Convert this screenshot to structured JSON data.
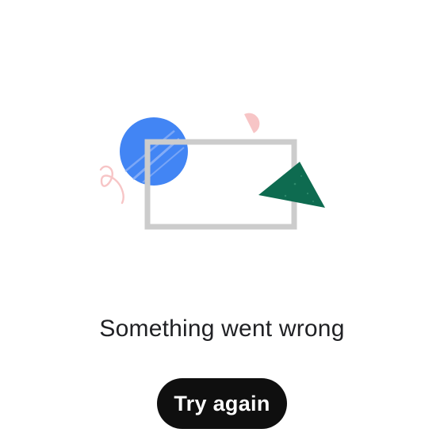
{
  "error": {
    "title": "Something went wrong",
    "retry_label": "Try again"
  },
  "illustration": {
    "circle_color": "#4285F4",
    "frame_color": "#CCCCCC",
    "triangle_color": "#0E6B50",
    "accent_color": "#F7C5C6",
    "icons": [
      "blue-circle-shape",
      "frame-rectangle-shape",
      "green-triangle-shape",
      "pink-half-circle-shape",
      "pink-squiggle-shape"
    ]
  },
  "colors": {
    "background": "#FFFFFF",
    "button_bg": "#0F0F0F",
    "button_text": "#FFFFFF",
    "text": "#202124"
  }
}
